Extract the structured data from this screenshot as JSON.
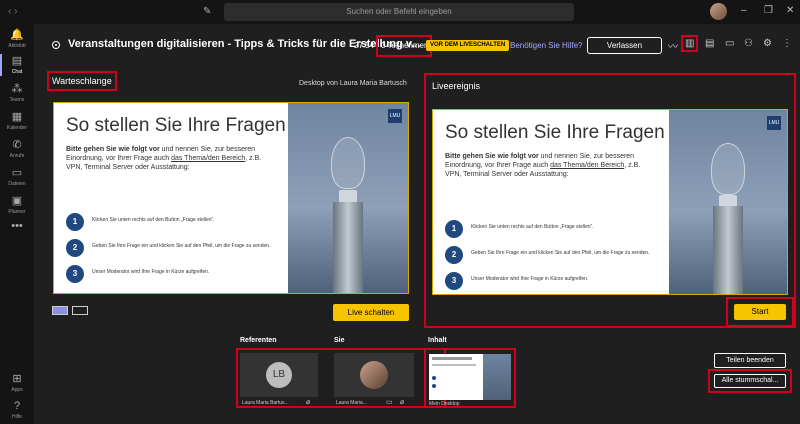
{
  "topbar": {
    "search_placeholder": "Suchen oder Befehl eingeben"
  },
  "rail": {
    "items": [
      {
        "label": "Aktivität",
        "icon": "bell-icon"
      },
      {
        "label": "Chat",
        "icon": "chat-icon"
      },
      {
        "label": "Teams",
        "icon": "teams-icon"
      },
      {
        "label": "Kalender",
        "icon": "calendar-icon"
      },
      {
        "label": "Anrufe",
        "icon": "phone-icon"
      },
      {
        "label": "Dateien",
        "icon": "files-icon"
      },
      {
        "label": "Planner",
        "icon": "planner-icon"
      },
      {
        "label": "Apps",
        "icon": "apps-icon"
      },
      {
        "label": "Hilfe",
        "icon": "help-icon"
      }
    ]
  },
  "header": {
    "title": "Veranstaltungen digitalisieren - Tipps & Tricks für die Erstellung v...",
    "timer": "27:54",
    "participants": "0 Teilnehmer",
    "live_badge": "VOR DEM LIVESCHALTEN",
    "help_link": "Benötigen Sie Hilfe?",
    "leave_label": "Verlassen"
  },
  "queue": {
    "label": "Warteschlange",
    "desktop_by": "Desktop von Laura Maria Bartusch",
    "go_live_label": "Live schalten"
  },
  "slide": {
    "title": "So stellen Sie Ihre Fragen",
    "intro_bold": "Bitte gehen Sie wie folgt vor",
    "intro_rest1": " und nennen Sie, zur besseren Einordnung, vor Ihrer Frage auch ",
    "intro_link": "das Thema/den Bereich",
    "intro_rest2": ", z.B. VPN, Terminal Server oder Ausstattung:",
    "steps": [
      {
        "num": "1",
        "text": "Klicken Sie unten rechts auf den Button „Frage stellen“."
      },
      {
        "num": "2",
        "text": "Geben Sie Ihre Frage ein und klicken Sie auf den Pfeil, um die Frage zu senden."
      },
      {
        "num": "3",
        "text": "Unser Moderator wird Ihre Frage in Kürze aufgreifen."
      }
    ],
    "logo": "LMU"
  },
  "live": {
    "label": "Liveereignis",
    "start_label": "Start"
  },
  "bottom": {
    "presenters_label": "Referenten",
    "you_label": "Sie",
    "content_label": "Inhalt",
    "presenter_initials": "LB",
    "presenter_name": "Laura Maria Bartus...",
    "you_name": "Laura Maria...",
    "content_name": "Mein Desktop",
    "stop_sharing_label": "Teilen beenden",
    "mute_all_label": "Alle stummschal..."
  }
}
